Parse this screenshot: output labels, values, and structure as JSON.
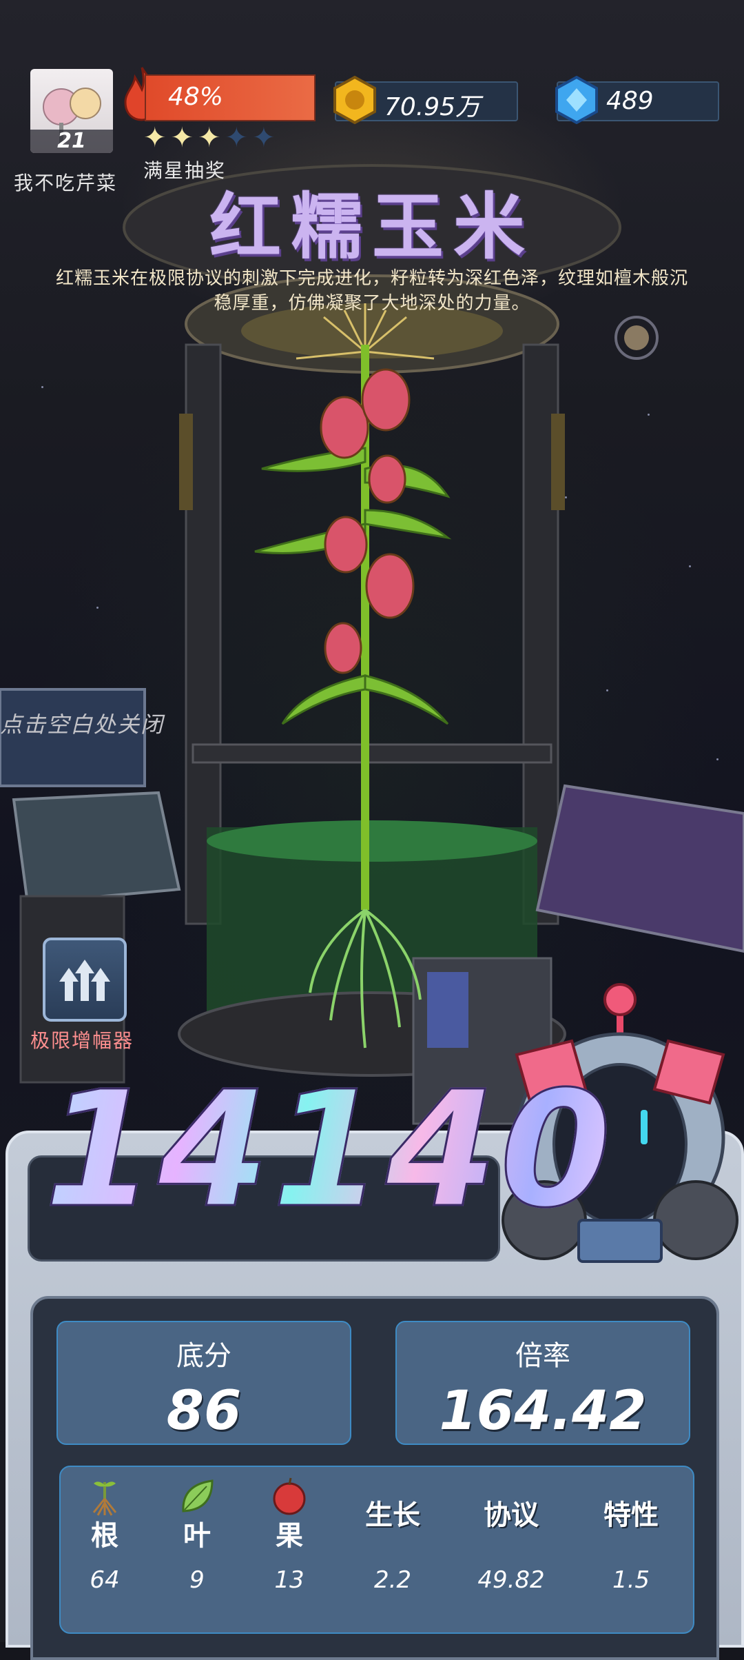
{
  "player": {
    "name": "我不吃芹菜",
    "level": "21"
  },
  "energy": {
    "percent_text": "48%",
    "percent": 48,
    "stars_filled": 3,
    "stars_total": 5,
    "lottery_label": "满星抽奖"
  },
  "resources": {
    "gold": "70.95万",
    "gems": "489"
  },
  "crop": {
    "name": "红糯玉米",
    "description": "红糯玉米在极限协议的刺激下完成进化，籽粒转为深红色泽，纹理如檀木般沉稳厚重，仿佛凝聚了大地深处的力量。"
  },
  "close_hint": "点击空白处关闭",
  "amplifier": {
    "label": "极限增幅器"
  },
  "score": {
    "total": "14140"
  },
  "stats": {
    "base": {
      "label": "底分",
      "value": "86"
    },
    "multiplier": {
      "label": "倍率",
      "value": "164.42"
    }
  },
  "attributes": [
    {
      "name": "根",
      "value": "64",
      "icon": "root-icon"
    },
    {
      "name": "叶",
      "value": "9",
      "icon": "leaf-icon"
    },
    {
      "name": "果",
      "value": "13",
      "icon": "fruit-icon"
    },
    {
      "name": "生长",
      "value": "2.2"
    },
    {
      "name": "协议",
      "value": "49.82"
    },
    {
      "name": "特性",
      "value": "1.5"
    }
  ],
  "colors": {
    "accent_title": "#cbb4f0",
    "fire_bar": "#e04a2a",
    "stat_panel": "#4a6584",
    "amp_label": "#ff8f8f"
  }
}
